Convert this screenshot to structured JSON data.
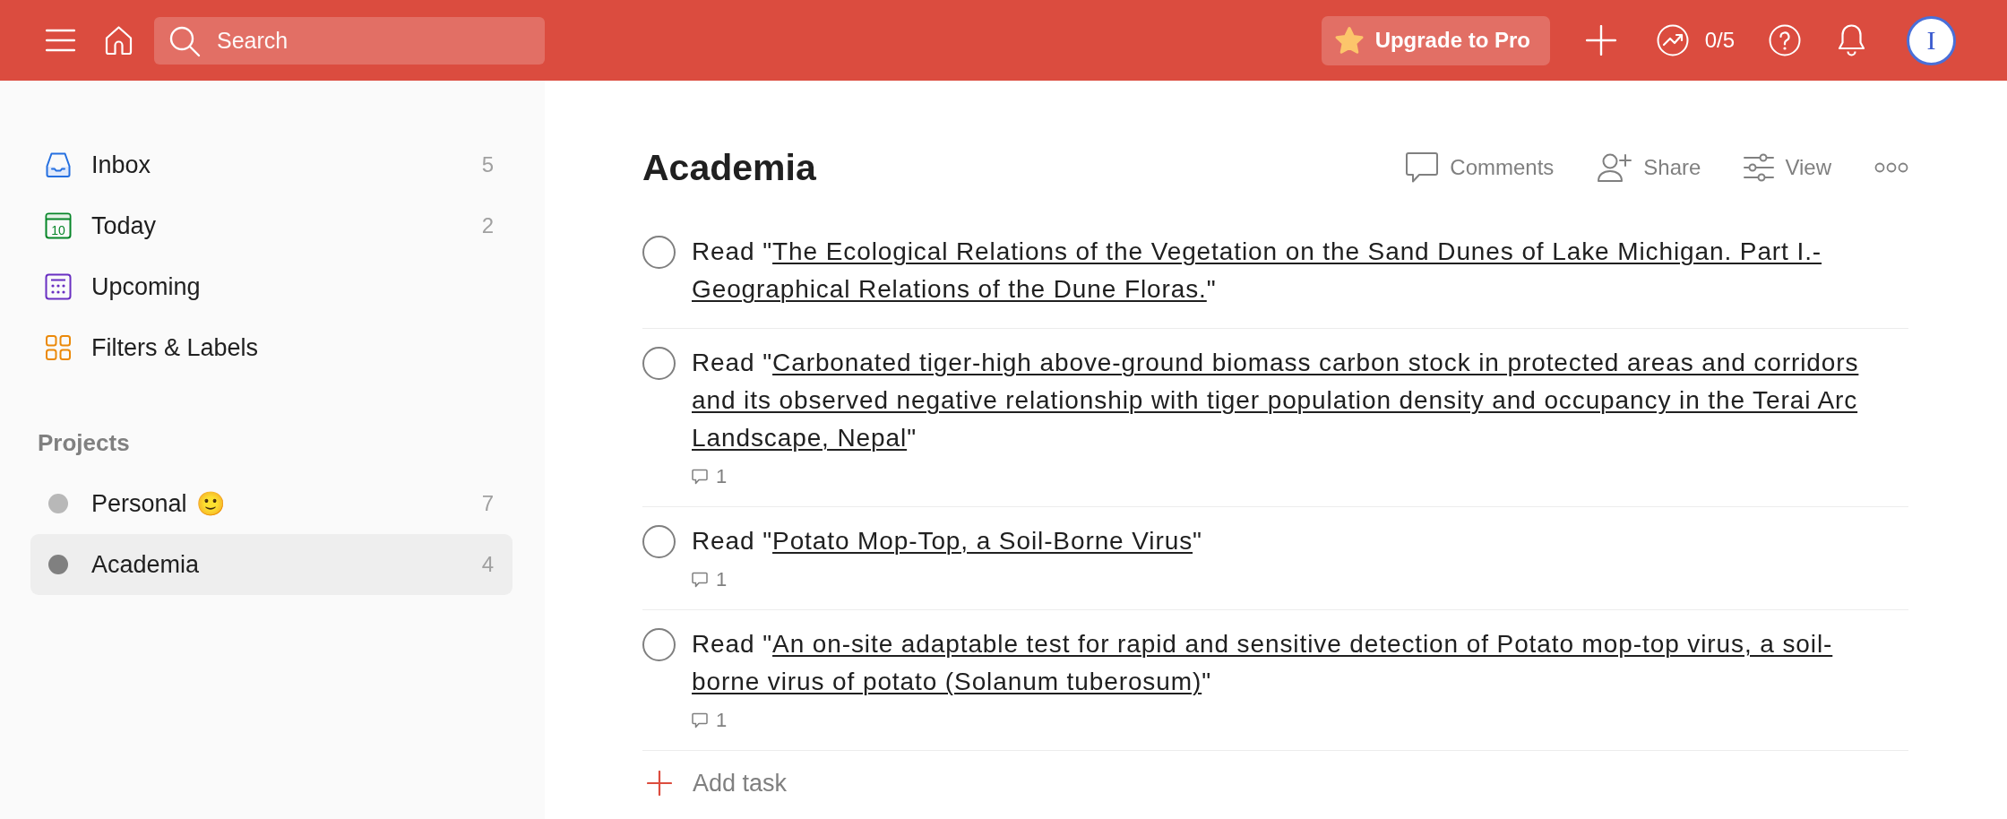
{
  "topbar": {
    "search": {
      "placeholder": "Search"
    },
    "upgrade_button": "Upgrade to Pro",
    "productivity": "0/5",
    "avatar_initial": "I"
  },
  "sidebar": {
    "items": [
      {
        "kind": "inbox",
        "label": "Inbox",
        "count": "5",
        "selected": false
      },
      {
        "kind": "today",
        "label": "Today",
        "date": "10",
        "count": "2",
        "selected": false
      },
      {
        "kind": "upcoming",
        "label": "Upcoming",
        "selected": false
      },
      {
        "kind": "filters",
        "label": "Filters & Labels",
        "selected": false
      }
    ],
    "projects_heading": "Projects",
    "projects": [
      {
        "name": "Personal",
        "emoji": "🙂",
        "count": "7",
        "color": "#b8b8b8",
        "selected": false
      },
      {
        "name": "Academia",
        "count": "4",
        "color": "#808080",
        "selected": true
      }
    ]
  },
  "project": {
    "title": "Academia",
    "actions": [
      {
        "kind": "comments",
        "label": "Comments"
      },
      {
        "kind": "share",
        "label": "Share"
      },
      {
        "kind": "view",
        "label": "View"
      },
      {
        "kind": "more"
      }
    ],
    "tasks": [
      {
        "checked": false,
        "before": "Read \"",
        "link": "The Ecological Relations of the Vegetation on the Sand Dunes of Lake Michigan. Part I.-Geographical Relations of the Dune Floras.",
        "after": "\""
      },
      {
        "checked": false,
        "before": "Read \"",
        "link": "Carbonated tiger-high above-ground biomass carbon stock in protected areas and corridors and its observed negative relationship with tiger population density and occupancy in the Terai Arc Landscape, Nepal",
        "after": "\"",
        "comments": "1"
      },
      {
        "checked": false,
        "before": "Read \"",
        "link": "Potato Mop-Top, a Soil-Borne Virus",
        "after": "\"",
        "comments": "1"
      },
      {
        "checked": false,
        "before": "Read \"",
        "link": "An on-site adaptable test for rapid and sensitive detection of Potato mop-top virus, a soil-borne virus of potato (Solanum tuberosum)",
        "after": "\"",
        "comments": "1"
      }
    ],
    "add_task": "Add task"
  }
}
